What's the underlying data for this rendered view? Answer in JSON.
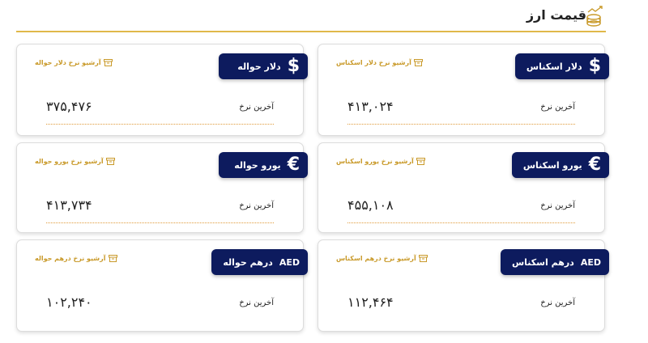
{
  "page": {
    "title": "قیمت ارز",
    "title_icon": "coin-stack-chart-icon",
    "accent": "#e0b84a",
    "badge_color": "#0d1b5e",
    "archive_color": "#c99a2a"
  },
  "cards": [
    {
      "badge_label": "دلار حواله",
      "symbol": "$",
      "archive_label": "آرشیو نرخ دلار حواله",
      "rate_label": "آخرین نرخ",
      "rate_value": "۳۷۵,۴۷۶"
    },
    {
      "badge_label": "دلار اسکناس",
      "symbol": "$",
      "archive_label": "آرشیو نرخ دلار اسکناس",
      "rate_label": "آخرین نرخ",
      "rate_value": "۴۱۳,۰۲۴"
    },
    {
      "badge_label": "یورو حواله",
      "symbol": "€",
      "archive_label": "آرشیو نرخ یورو حواله",
      "rate_label": "آخرین نرخ",
      "rate_value": "۴۱۳,۷۳۴"
    },
    {
      "badge_label": "یورو اسکناس",
      "symbol": "€",
      "archive_label": "آرشیو نرخ یورو اسکناس",
      "rate_label": "آخرین نرخ",
      "rate_value": "۴۵۵,۱۰۸"
    },
    {
      "badge_label": "درهم حواله",
      "symbol": "AED",
      "archive_label": "آرشیو نرخ درهم حواله",
      "rate_label": "آخرین نرخ",
      "rate_value": "۱۰۲,۲۴۰"
    },
    {
      "badge_label": "درهم اسکناس",
      "symbol": "AED",
      "archive_label": "آرشیو نرخ درهم اسکناس",
      "rate_label": "آخرین نرخ",
      "rate_value": "۱۱۲,۴۶۴"
    }
  ]
}
